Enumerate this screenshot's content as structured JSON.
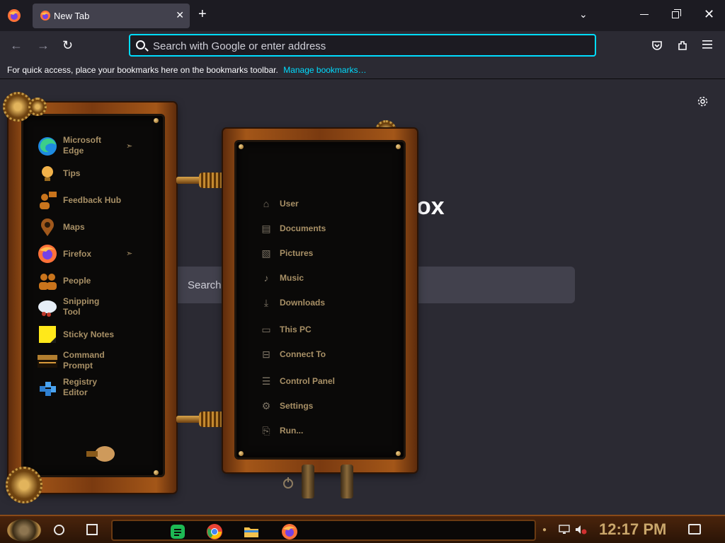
{
  "browser": {
    "tab_title": "New Tab",
    "tab_close": "✕",
    "new_tab": "+",
    "all_tabs": "⌄",
    "window_close": "✕",
    "address_placeholder": "Search with Google or enter address",
    "bookmarks_message": "For quick access, place your bookmarks here on the bookmarks toolbar.",
    "bookmarks_link": "Manage bookmarks…",
    "accent_color": "#00ddff"
  },
  "newtab": {
    "logo_fragment": "ox",
    "search_placeholder_fragment": "Search"
  },
  "start_menu": {
    "apps": [
      {
        "label": "Microsoft Edge",
        "icon": "edge-icon",
        "has_arrow": true
      },
      {
        "label": "Tips",
        "icon": "lightbulb-icon",
        "has_arrow": false
      },
      {
        "label": "Feedback Hub",
        "icon": "feedback-icon",
        "has_arrow": false
      },
      {
        "label": "Maps",
        "icon": "map-pin-icon",
        "has_arrow": false
      },
      {
        "label": "Firefox",
        "icon": "firefox-icon",
        "has_arrow": true
      },
      {
        "label": "People",
        "icon": "people-icon",
        "has_arrow": false
      },
      {
        "label": "Snipping Tool",
        "icon": "scissors-icon",
        "has_arrow": false
      },
      {
        "label": "Sticky Notes",
        "icon": "sticky-note-icon",
        "has_arrow": false
      },
      {
        "label": "Command Prompt",
        "icon": "terminal-icon",
        "has_arrow": false
      },
      {
        "label": "Registry Editor",
        "icon": "registry-icon",
        "has_arrow": false
      }
    ],
    "arrow_glyph": "➣",
    "places": [
      {
        "label": "User",
        "icon": "user-icon"
      },
      {
        "label": "Documents",
        "icon": "document-icon"
      },
      {
        "label": "Pictures",
        "icon": "picture-icon"
      },
      {
        "label": "Music",
        "icon": "music-icon"
      },
      {
        "label": "Downloads",
        "icon": "download-icon"
      },
      {
        "label": "This PC",
        "icon": "monitor-icon"
      },
      {
        "label": "Connect To",
        "icon": "network-icon"
      },
      {
        "label": "Control Panel",
        "icon": "control-panel-icon"
      },
      {
        "label": "Settings",
        "icon": "gear-icon"
      },
      {
        "label": "Run...",
        "icon": "run-icon"
      }
    ],
    "frame_color": "#a35618",
    "text_color": "#a89066"
  },
  "taskbar": {
    "clock": "12:17 PM",
    "pinned": [
      "sheets-icon",
      "chrome-icon",
      "file-explorer-icon",
      "firefox-icon"
    ]
  }
}
